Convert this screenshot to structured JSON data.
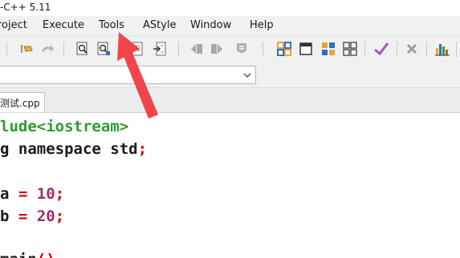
{
  "window": {
    "title": "-C++ 5.11"
  },
  "menubar": {
    "items": [
      "roject",
      "Execute",
      "Tools",
      "AStyle",
      "Window",
      "Help"
    ]
  },
  "toolbar": {
    "buttons": [
      "undo-icon",
      "redo-icon",
      "find-icon",
      "replace-icon",
      "goto-icon",
      "goto-line-icon",
      "back-icon",
      "forward-icon",
      "bookmark-icon",
      "compile-icon",
      "run-icon",
      "compile-run-icon",
      "rebuild-icon",
      "check-icon",
      "stop-icon",
      "chart-icon"
    ],
    "accent_colors": {
      "grid_orange": "#e8a23a",
      "grid_blue": "#2d6fc4",
      "check_purple": "#9b59c8"
    }
  },
  "editor_tabs": [
    {
      "label": "测试.cpp",
      "active": true
    }
  ],
  "code": {
    "lines": [
      {
        "segments": [
          {
            "text": "lude<iostream>",
            "color": "green"
          }
        ]
      },
      {
        "segments": [
          {
            "text": "g namespace std",
            "color": "dark"
          },
          {
            "text": ";",
            "color": "red"
          }
        ]
      },
      {
        "segments": []
      },
      {
        "segments": [
          {
            "text": "a ",
            "color": "dark"
          },
          {
            "text": "= ",
            "color": "red"
          },
          {
            "text": "10",
            "color": "purple"
          },
          {
            "text": ";",
            "color": "red"
          }
        ]
      },
      {
        "segments": [
          {
            "text": "b ",
            "color": "dark"
          },
          {
            "text": "= ",
            "color": "red"
          },
          {
            "text": "20",
            "color": "purple"
          },
          {
            "text": ";",
            "color": "red"
          }
        ]
      },
      {
        "segments": []
      },
      {
        "segments": [
          {
            "text": "main",
            "color": "dark"
          },
          {
            "text": "()",
            "color": "red"
          }
        ]
      }
    ]
  },
  "annotation": {
    "arrow_color": "#f0454d"
  }
}
